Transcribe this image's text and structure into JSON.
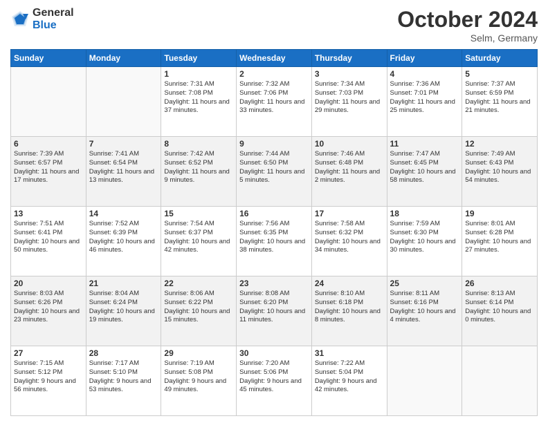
{
  "header": {
    "logo_general": "General",
    "logo_blue": "Blue",
    "title": "October 2024",
    "location": "Selm, Germany"
  },
  "weekdays": [
    "Sunday",
    "Monday",
    "Tuesday",
    "Wednesday",
    "Thursday",
    "Friday",
    "Saturday"
  ],
  "weeks": [
    [
      {
        "day": "",
        "info": ""
      },
      {
        "day": "",
        "info": ""
      },
      {
        "day": "1",
        "info": "Sunrise: 7:31 AM\nSunset: 7:08 PM\nDaylight: 11 hours and 37 minutes."
      },
      {
        "day": "2",
        "info": "Sunrise: 7:32 AM\nSunset: 7:06 PM\nDaylight: 11 hours and 33 minutes."
      },
      {
        "day": "3",
        "info": "Sunrise: 7:34 AM\nSunset: 7:03 PM\nDaylight: 11 hours and 29 minutes."
      },
      {
        "day": "4",
        "info": "Sunrise: 7:36 AM\nSunset: 7:01 PM\nDaylight: 11 hours and 25 minutes."
      },
      {
        "day": "5",
        "info": "Sunrise: 7:37 AM\nSunset: 6:59 PM\nDaylight: 11 hours and 21 minutes."
      }
    ],
    [
      {
        "day": "6",
        "info": "Sunrise: 7:39 AM\nSunset: 6:57 PM\nDaylight: 11 hours and 17 minutes."
      },
      {
        "day": "7",
        "info": "Sunrise: 7:41 AM\nSunset: 6:54 PM\nDaylight: 11 hours and 13 minutes."
      },
      {
        "day": "8",
        "info": "Sunrise: 7:42 AM\nSunset: 6:52 PM\nDaylight: 11 hours and 9 minutes."
      },
      {
        "day": "9",
        "info": "Sunrise: 7:44 AM\nSunset: 6:50 PM\nDaylight: 11 hours and 5 minutes."
      },
      {
        "day": "10",
        "info": "Sunrise: 7:46 AM\nSunset: 6:48 PM\nDaylight: 11 hours and 2 minutes."
      },
      {
        "day": "11",
        "info": "Sunrise: 7:47 AM\nSunset: 6:45 PM\nDaylight: 10 hours and 58 minutes."
      },
      {
        "day": "12",
        "info": "Sunrise: 7:49 AM\nSunset: 6:43 PM\nDaylight: 10 hours and 54 minutes."
      }
    ],
    [
      {
        "day": "13",
        "info": "Sunrise: 7:51 AM\nSunset: 6:41 PM\nDaylight: 10 hours and 50 minutes."
      },
      {
        "day": "14",
        "info": "Sunrise: 7:52 AM\nSunset: 6:39 PM\nDaylight: 10 hours and 46 minutes."
      },
      {
        "day": "15",
        "info": "Sunrise: 7:54 AM\nSunset: 6:37 PM\nDaylight: 10 hours and 42 minutes."
      },
      {
        "day": "16",
        "info": "Sunrise: 7:56 AM\nSunset: 6:35 PM\nDaylight: 10 hours and 38 minutes."
      },
      {
        "day": "17",
        "info": "Sunrise: 7:58 AM\nSunset: 6:32 PM\nDaylight: 10 hours and 34 minutes."
      },
      {
        "day": "18",
        "info": "Sunrise: 7:59 AM\nSunset: 6:30 PM\nDaylight: 10 hours and 30 minutes."
      },
      {
        "day": "19",
        "info": "Sunrise: 8:01 AM\nSunset: 6:28 PM\nDaylight: 10 hours and 27 minutes."
      }
    ],
    [
      {
        "day": "20",
        "info": "Sunrise: 8:03 AM\nSunset: 6:26 PM\nDaylight: 10 hours and 23 minutes."
      },
      {
        "day": "21",
        "info": "Sunrise: 8:04 AM\nSunset: 6:24 PM\nDaylight: 10 hours and 19 minutes."
      },
      {
        "day": "22",
        "info": "Sunrise: 8:06 AM\nSunset: 6:22 PM\nDaylight: 10 hours and 15 minutes."
      },
      {
        "day": "23",
        "info": "Sunrise: 8:08 AM\nSunset: 6:20 PM\nDaylight: 10 hours and 11 minutes."
      },
      {
        "day": "24",
        "info": "Sunrise: 8:10 AM\nSunset: 6:18 PM\nDaylight: 10 hours and 8 minutes."
      },
      {
        "day": "25",
        "info": "Sunrise: 8:11 AM\nSunset: 6:16 PM\nDaylight: 10 hours and 4 minutes."
      },
      {
        "day": "26",
        "info": "Sunrise: 8:13 AM\nSunset: 6:14 PM\nDaylight: 10 hours and 0 minutes."
      }
    ],
    [
      {
        "day": "27",
        "info": "Sunrise: 7:15 AM\nSunset: 5:12 PM\nDaylight: 9 hours and 56 minutes."
      },
      {
        "day": "28",
        "info": "Sunrise: 7:17 AM\nSunset: 5:10 PM\nDaylight: 9 hours and 53 minutes."
      },
      {
        "day": "29",
        "info": "Sunrise: 7:19 AM\nSunset: 5:08 PM\nDaylight: 9 hours and 49 minutes."
      },
      {
        "day": "30",
        "info": "Sunrise: 7:20 AM\nSunset: 5:06 PM\nDaylight: 9 hours and 45 minutes."
      },
      {
        "day": "31",
        "info": "Sunrise: 7:22 AM\nSunset: 5:04 PM\nDaylight: 9 hours and 42 minutes."
      },
      {
        "day": "",
        "info": ""
      },
      {
        "day": "",
        "info": ""
      }
    ]
  ]
}
